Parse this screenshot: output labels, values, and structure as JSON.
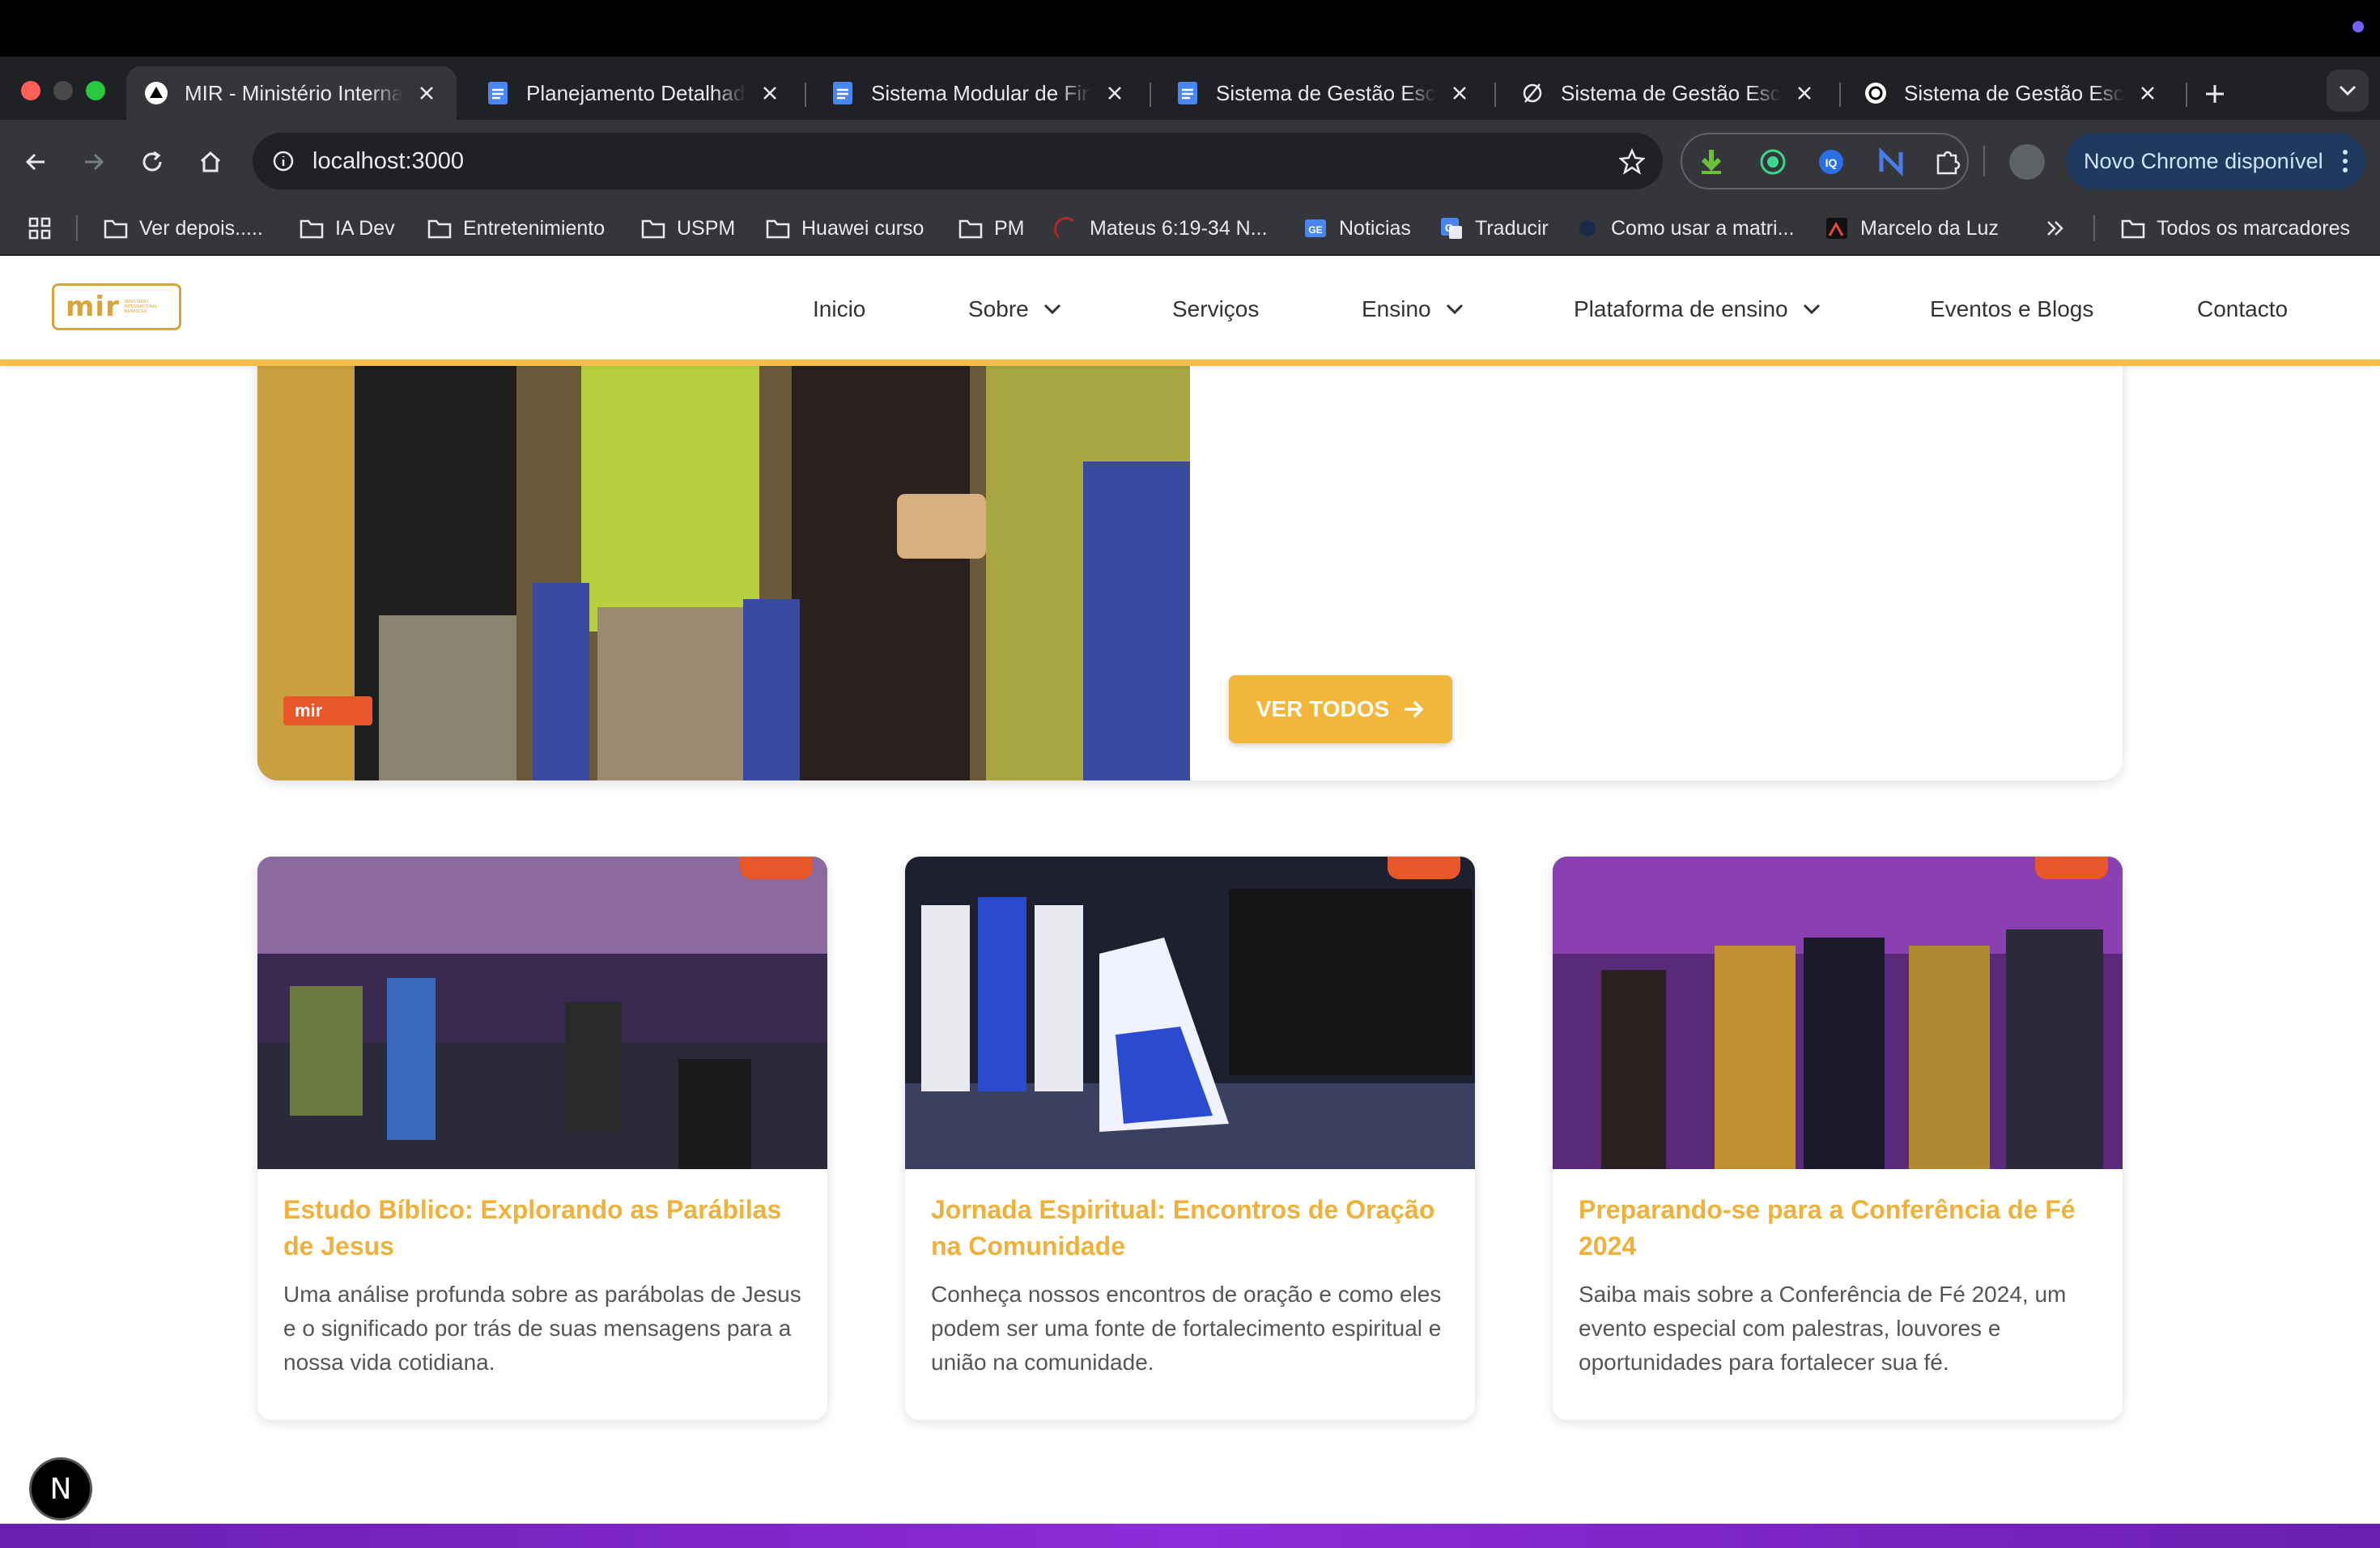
{
  "browser": {
    "tabs": [
      {
        "label": "MIR - Ministério Internacional",
        "icon": "vercel-icon",
        "active": true
      },
      {
        "label": "Planejamento Detalhado",
        "icon": "google-docs-icon"
      },
      {
        "label": "Sistema Modular de Finanças",
        "icon": "google-docs-icon"
      },
      {
        "label": "Sistema de Gestão Escolar",
        "icon": "google-docs-icon"
      },
      {
        "label": "Sistema de Gestão Escolar",
        "icon": "ai-studio-icon"
      },
      {
        "label": "Sistema de Gestão Escolar",
        "icon": "openai-icon"
      }
    ],
    "url": "localhost:3000",
    "update_label": "Novo Chrome disponível",
    "bookmarks": [
      {
        "label": "Ver depois.....",
        "icon": "folder-icon"
      },
      {
        "label": "IA Dev",
        "icon": "folder-icon"
      },
      {
        "label": "Entretenimiento",
        "icon": "folder-icon"
      },
      {
        "label": "USPM",
        "icon": "folder-icon"
      },
      {
        "label": "Huawei curso",
        "icon": "folder-icon"
      },
      {
        "label": "PM",
        "icon": "folder-icon"
      },
      {
        "label": "Mateus 6:19-34 N...",
        "icon": "page-icon"
      },
      {
        "label": "Noticias",
        "icon": "google-news-icon"
      },
      {
        "label": "Traducir",
        "icon": "translate-icon"
      },
      {
        "label": "Como usar a matri...",
        "icon": "page-icon"
      },
      {
        "label": "Marcelo da Luz",
        "icon": "page-icon"
      }
    ],
    "all_bookmarks_label": "Todos os marcadores"
  },
  "site": {
    "logo_text": "mir",
    "logo_subtext": "MINISTÉRIO INTERNACIONAL RENASCER",
    "nav": [
      {
        "label": "Inicio",
        "dropdown": false
      },
      {
        "label": "Sobre",
        "dropdown": true
      },
      {
        "label": "Serviços",
        "dropdown": false
      },
      {
        "label": "Ensino",
        "dropdown": true
      },
      {
        "label": "Plataforma de ensino",
        "dropdown": true
      },
      {
        "label": "Eventos e Blogs",
        "dropdown": false
      },
      {
        "label": "Contacto",
        "dropdown": false
      }
    ],
    "feature": {
      "view_all_label": "VER TODOS",
      "watermark": "mir"
    },
    "posts": [
      {
        "title": "Estudo Bíblico: Explorando as Parábilas de Jesus",
        "description": "Uma análise profunda sobre as parábolas de Jesus e o significado por trás de suas mensagens para a nossa vida cotidiana."
      },
      {
        "title": "Jornada Espiritual: Encontros de Oração na Comunidade",
        "description": "Conheça nossos encontros de oração e como eles podem ser uma fonte de fortalecimento espiritual e união na comunidade."
      },
      {
        "title": "Preparando-se para a Conferência de Fé 2024",
        "description": "Saiba mais sobre a Conferência de Fé 2024, um evento especial com palestras, louvores e oportunidades para fortalecer sua fé."
      }
    ],
    "next_badge": "N"
  },
  "colors": {
    "accent": "#f2b73a",
    "title": "#f0b13a",
    "band": "#8d2bd8"
  }
}
